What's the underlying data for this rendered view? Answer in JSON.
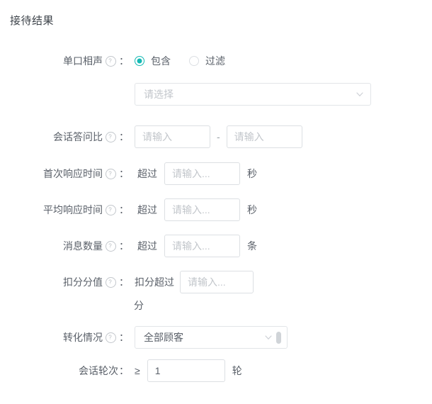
{
  "section": {
    "title": "接待结果"
  },
  "colors": {
    "accent": "#15b9b4",
    "label_text": "#5a6069",
    "placeholder": "#c2c6cb",
    "border": "#dcdfe3",
    "background": "#ffffff"
  },
  "rows": {
    "monologue": {
      "label": "单口相声",
      "colon": "：",
      "help_icon": "question-circle-icon",
      "options": [
        {
          "label": "包含",
          "selected": true
        },
        {
          "label": "过滤",
          "selected": false
        }
      ]
    },
    "monologue_select": {
      "value": "",
      "placeholder": "请选择",
      "chevron_icon": "chevron-down-icon"
    },
    "ratio": {
      "label": "会话答问比",
      "colon": "：",
      "help_icon": "question-circle-icon",
      "min_value": "",
      "min_placeholder": "请输入",
      "separator": "-",
      "max_value": "",
      "max_placeholder": "请输入"
    },
    "first_response": {
      "label": "首次响应时间",
      "colon": "：",
      "help_icon": "question-circle-icon",
      "operator": "超过",
      "value": "",
      "placeholder": "请输入...",
      "unit": "秒"
    },
    "avg_response": {
      "label": "平均响应时间",
      "colon": "：",
      "help_icon": "question-circle-icon",
      "operator": "超过",
      "value": "",
      "placeholder": "请输入...",
      "unit": "秒"
    },
    "message_count": {
      "label": "消息数量",
      "colon": "：",
      "help_icon": "question-circle-icon",
      "operator": "超过",
      "value": "",
      "placeholder": "请输入...",
      "unit": "条"
    },
    "deduction": {
      "label": "扣分分值",
      "colon": "：",
      "help_icon": "question-circle-icon",
      "operator": "扣分超过",
      "value": "",
      "placeholder": "请输入...",
      "unit": "分"
    },
    "conversion": {
      "label": "转化情况",
      "colon": "：",
      "help_icon": "question-circle-icon",
      "value": "全部顾客",
      "chevron_icon": "chevron-down-icon",
      "scrollbar": "select-scrollbar-thumb"
    },
    "rounds": {
      "label": "会话轮次",
      "colon": "：",
      "operator": "≥",
      "value": "1",
      "unit": "轮"
    }
  }
}
